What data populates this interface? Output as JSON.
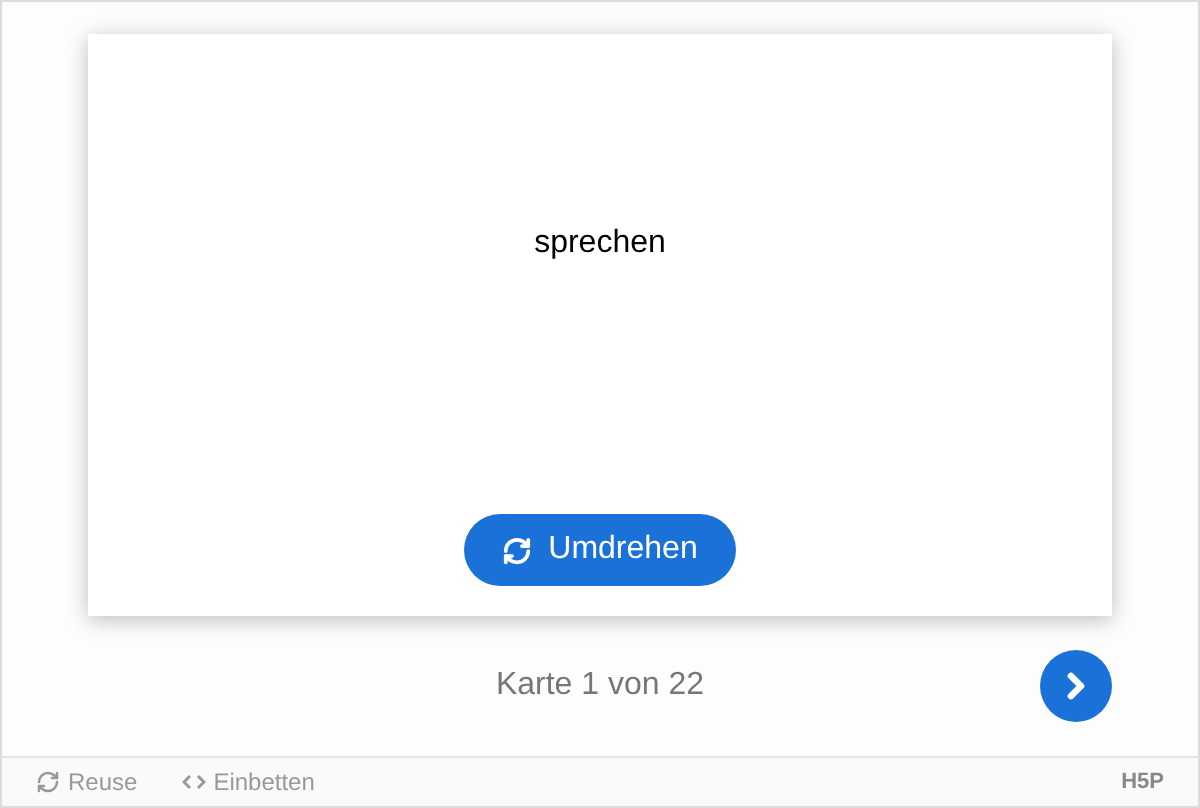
{
  "card": {
    "word": "sprechen",
    "flip_button": "Umdrehen"
  },
  "progress": "Karte 1 von 22",
  "footer": {
    "actions": [
      {
        "kind": "reuse",
        "label": "Reuse"
      },
      {
        "kind": "embed",
        "label": "Einbetten"
      }
    ],
    "logo": "H5P"
  }
}
